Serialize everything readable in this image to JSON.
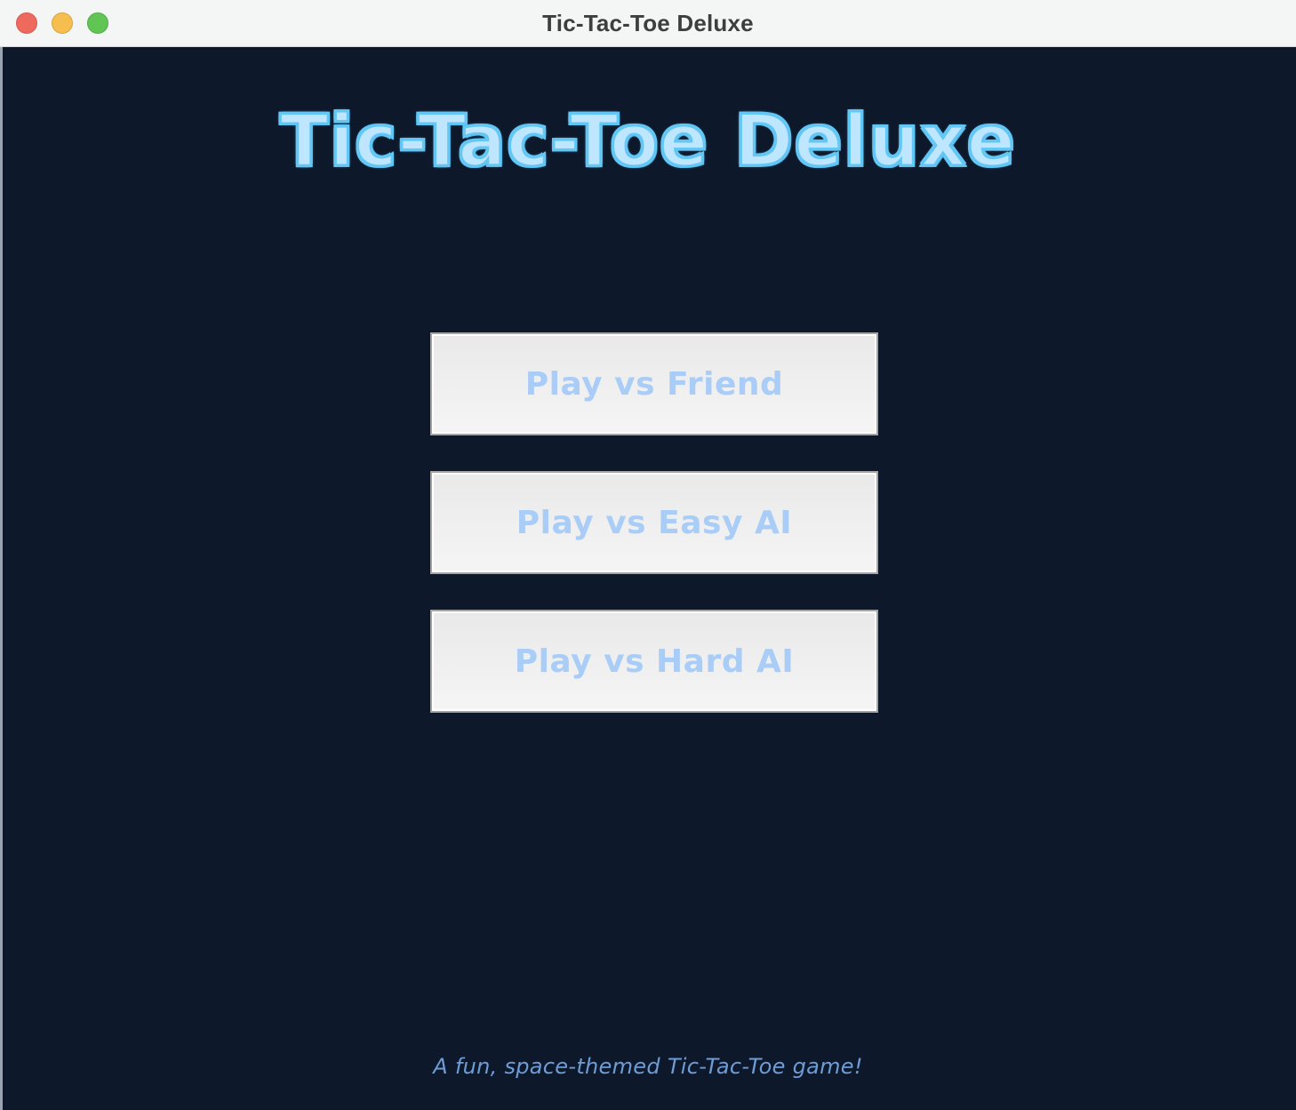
{
  "window": {
    "title": "Tic-Tac-Toe Deluxe",
    "controls": [
      "close-icon",
      "minimize-icon",
      "zoom-icon"
    ]
  },
  "main": {
    "title": "Tic-Tac-Toe Deluxe",
    "buttons": [
      {
        "label": "Play vs Friend"
      },
      {
        "label": "Play vs Easy AI"
      },
      {
        "label": "Play vs Hard AI"
      }
    ],
    "footer": "A fun, space-themed Tic-Tac-Toe game!"
  },
  "colors": {
    "background": "#0e182b",
    "title_fill": "#bfe6ff",
    "title_outline": "#62c7f5",
    "button_text": "#a9cdf6",
    "footer_text": "#6e9dd6"
  }
}
